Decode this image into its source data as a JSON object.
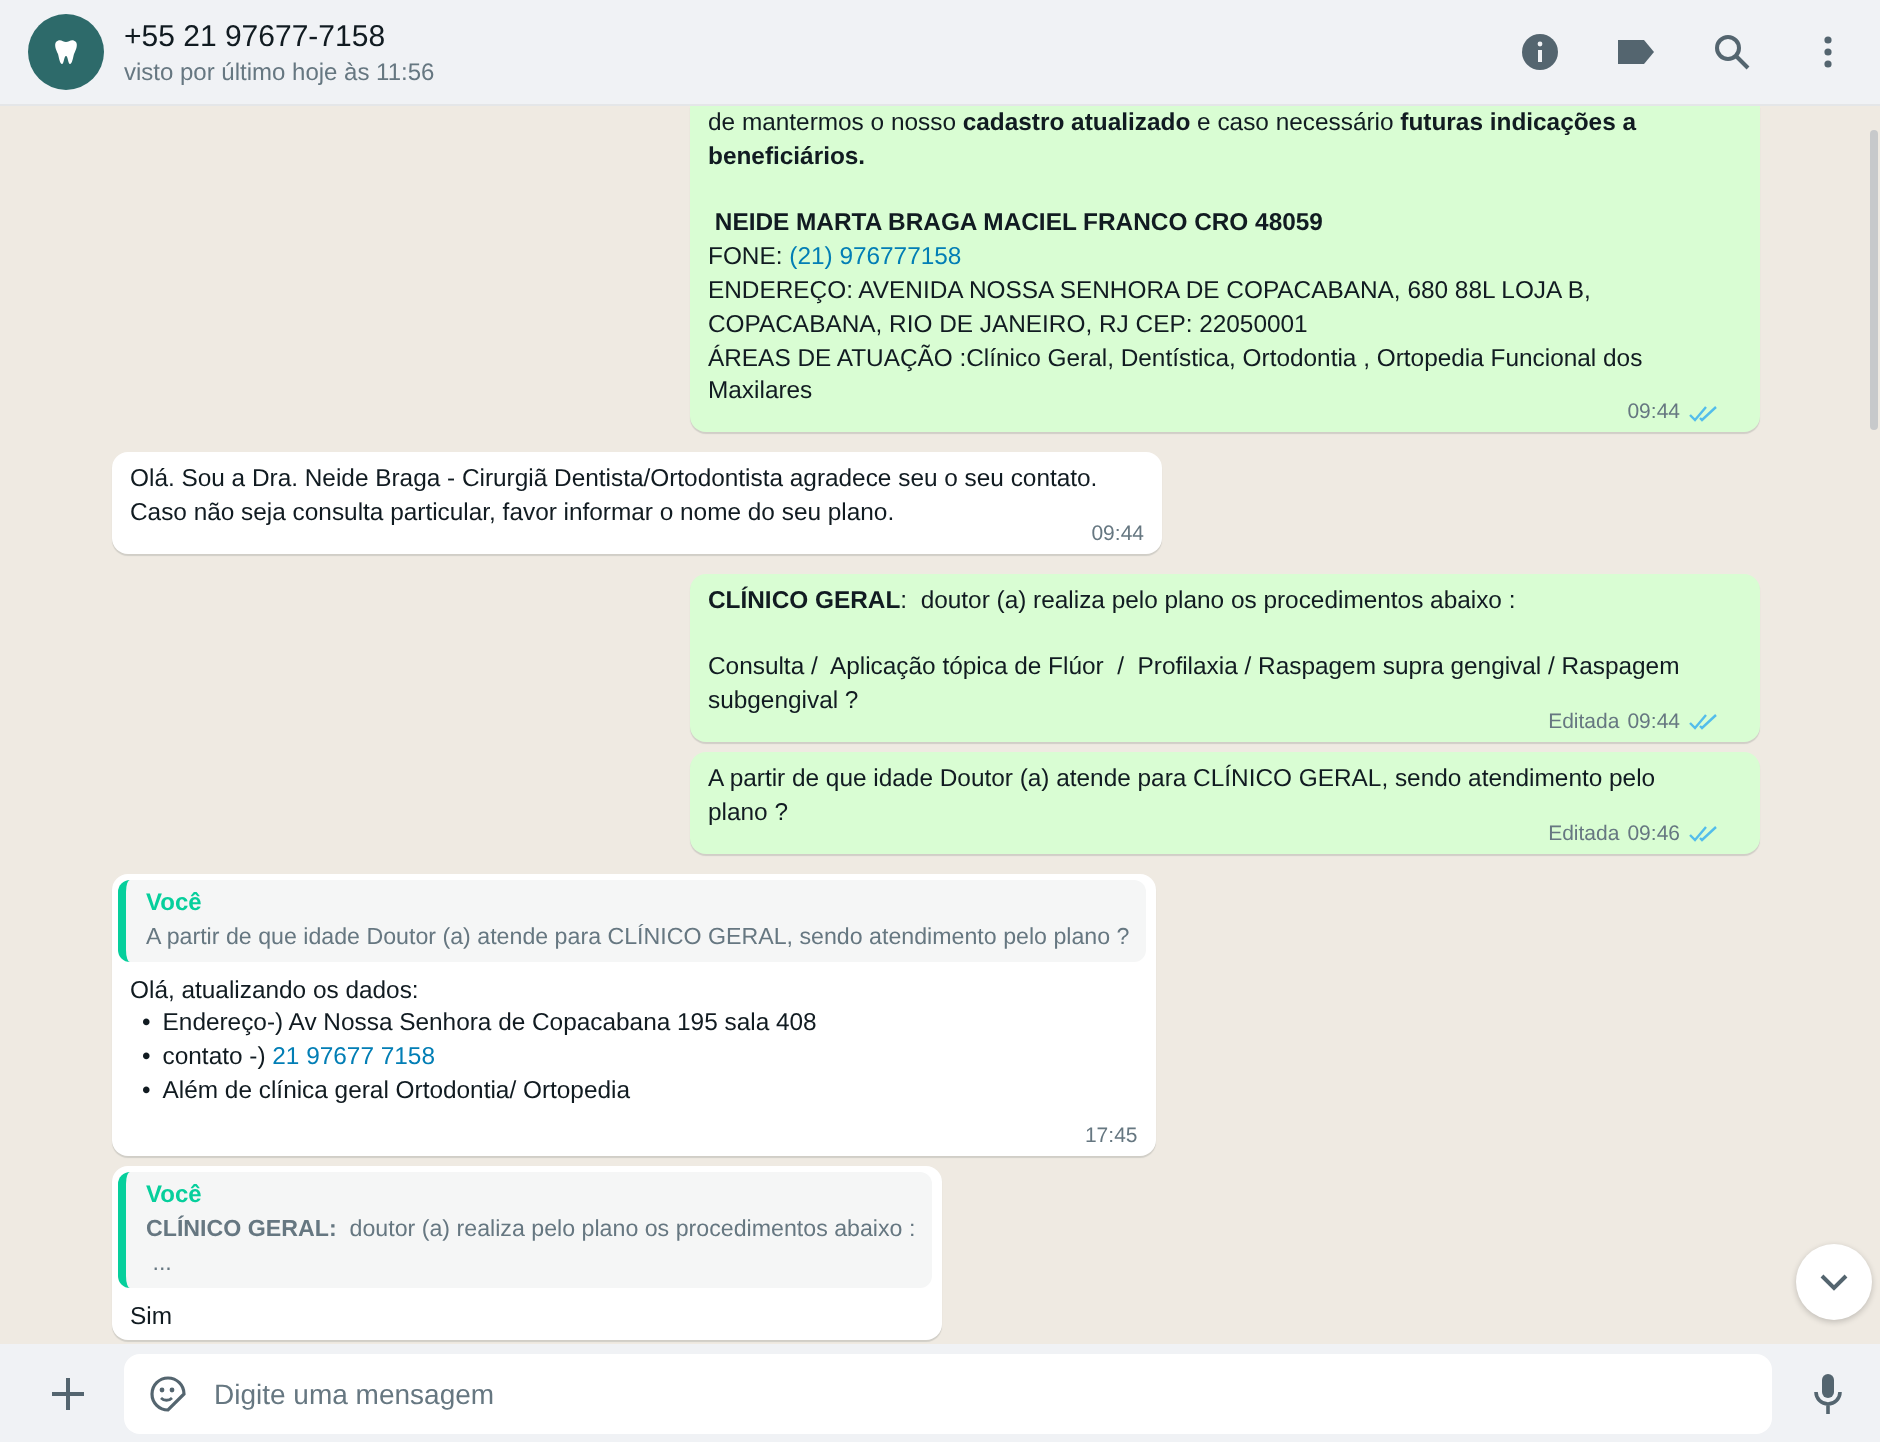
{
  "header": {
    "contact": "+55 21 97677-7158",
    "status": "visto por último hoje às 11:56"
  },
  "messages": [
    {
      "kind": "outgoing",
      "paragraphs": [
        [
          {
            "text": "de mantermos o nosso **cadastro atualizado** e caso necessário **futuras indicações a beneficiários.**"
          }
        ],
        [
          {
            "text": " **NEIDE MARTA BRAGA MACIEL FRANCO CRO 48059**"
          },
          {
            "text": "FONE: ",
            "link": "(21) 976777158"
          },
          {
            "text": "ENDEREÇO: AVENIDA NOSSA SENHORA DE COPACABANA, 680 88L LOJA B, COPACABANA, RIO DE JANEIRO, RJ CEP: 22050001"
          },
          {
            "text": "ÁREAS DE ATUAÇÃO :Clínico Geral, Dentística, Ortodontia , Ortopedia Funcional dos Maxilares"
          }
        ]
      ],
      "time": "09:44",
      "read": true
    },
    {
      "kind": "incoming",
      "paragraphs": [
        [
          {
            "text": "Olá. Sou a Dra. Neide Braga - Cirurgiã Dentista/Ortodontista agradece seu o seu contato. Caso não seja consulta particular, favor informar o nome do seu plano."
          }
        ]
      ],
      "time": "09:44"
    },
    {
      "kind": "outgoing",
      "paragraphs": [
        [
          {
            "text": "**CLÍNICO GERAL**:  doutor (a) realiza pelo plano os procedimentos abaixo :"
          }
        ],
        [
          {
            "text": "Consulta /  Aplicação tópica de Flúor  /  Profilaxia / Raspagem supra gengival / Raspagem subgengival ?"
          }
        ]
      ],
      "edited": "Editada",
      "time": "09:44",
      "read": true
    },
    {
      "kind": "outgoing",
      "paragraphs": [
        [
          {
            "text": "A partir de que idade Doutor (a) atende para CLÍNICO GERAL, sendo atendimento pelo plano ?"
          }
        ]
      ],
      "edited": "Editada",
      "time": "09:46",
      "read": true
    },
    {
      "kind": "incoming",
      "quote": {
        "author": "Você",
        "lines": [
          "A partir de que idade Doutor (a) atende para CLÍNICO GERAL, sendo atendimento pelo plano ?"
        ]
      },
      "paragraphs": [
        [
          {
            "text": "Olá, atualizando os dados:"
          },
          {
            "bullet": "•",
            "text": "Endereço-) Av Nossa Senhora de Copacabana 195 sala 408"
          },
          {
            "bullet": "•",
            "text": "contato -) ",
            "link": "21 97677 7158"
          },
          {
            "bullet": "•",
            "text": "Além de clínica geral Ortodontia/ Ortopedia"
          }
        ]
      ],
      "time": "17:45"
    },
    {
      "kind": "incoming",
      "quote": {
        "author": "Você",
        "lines": [
          "**CLÍNICO GERAL:**  doutor (a) realiza pelo plano os procedimentos abaixo :",
          " ..."
        ]
      },
      "paragraphs": [
        [
          {
            "text": "Sim"
          }
        ]
      ]
    }
  ],
  "composer": {
    "placeholder": "Digite uma mensagem"
  }
}
